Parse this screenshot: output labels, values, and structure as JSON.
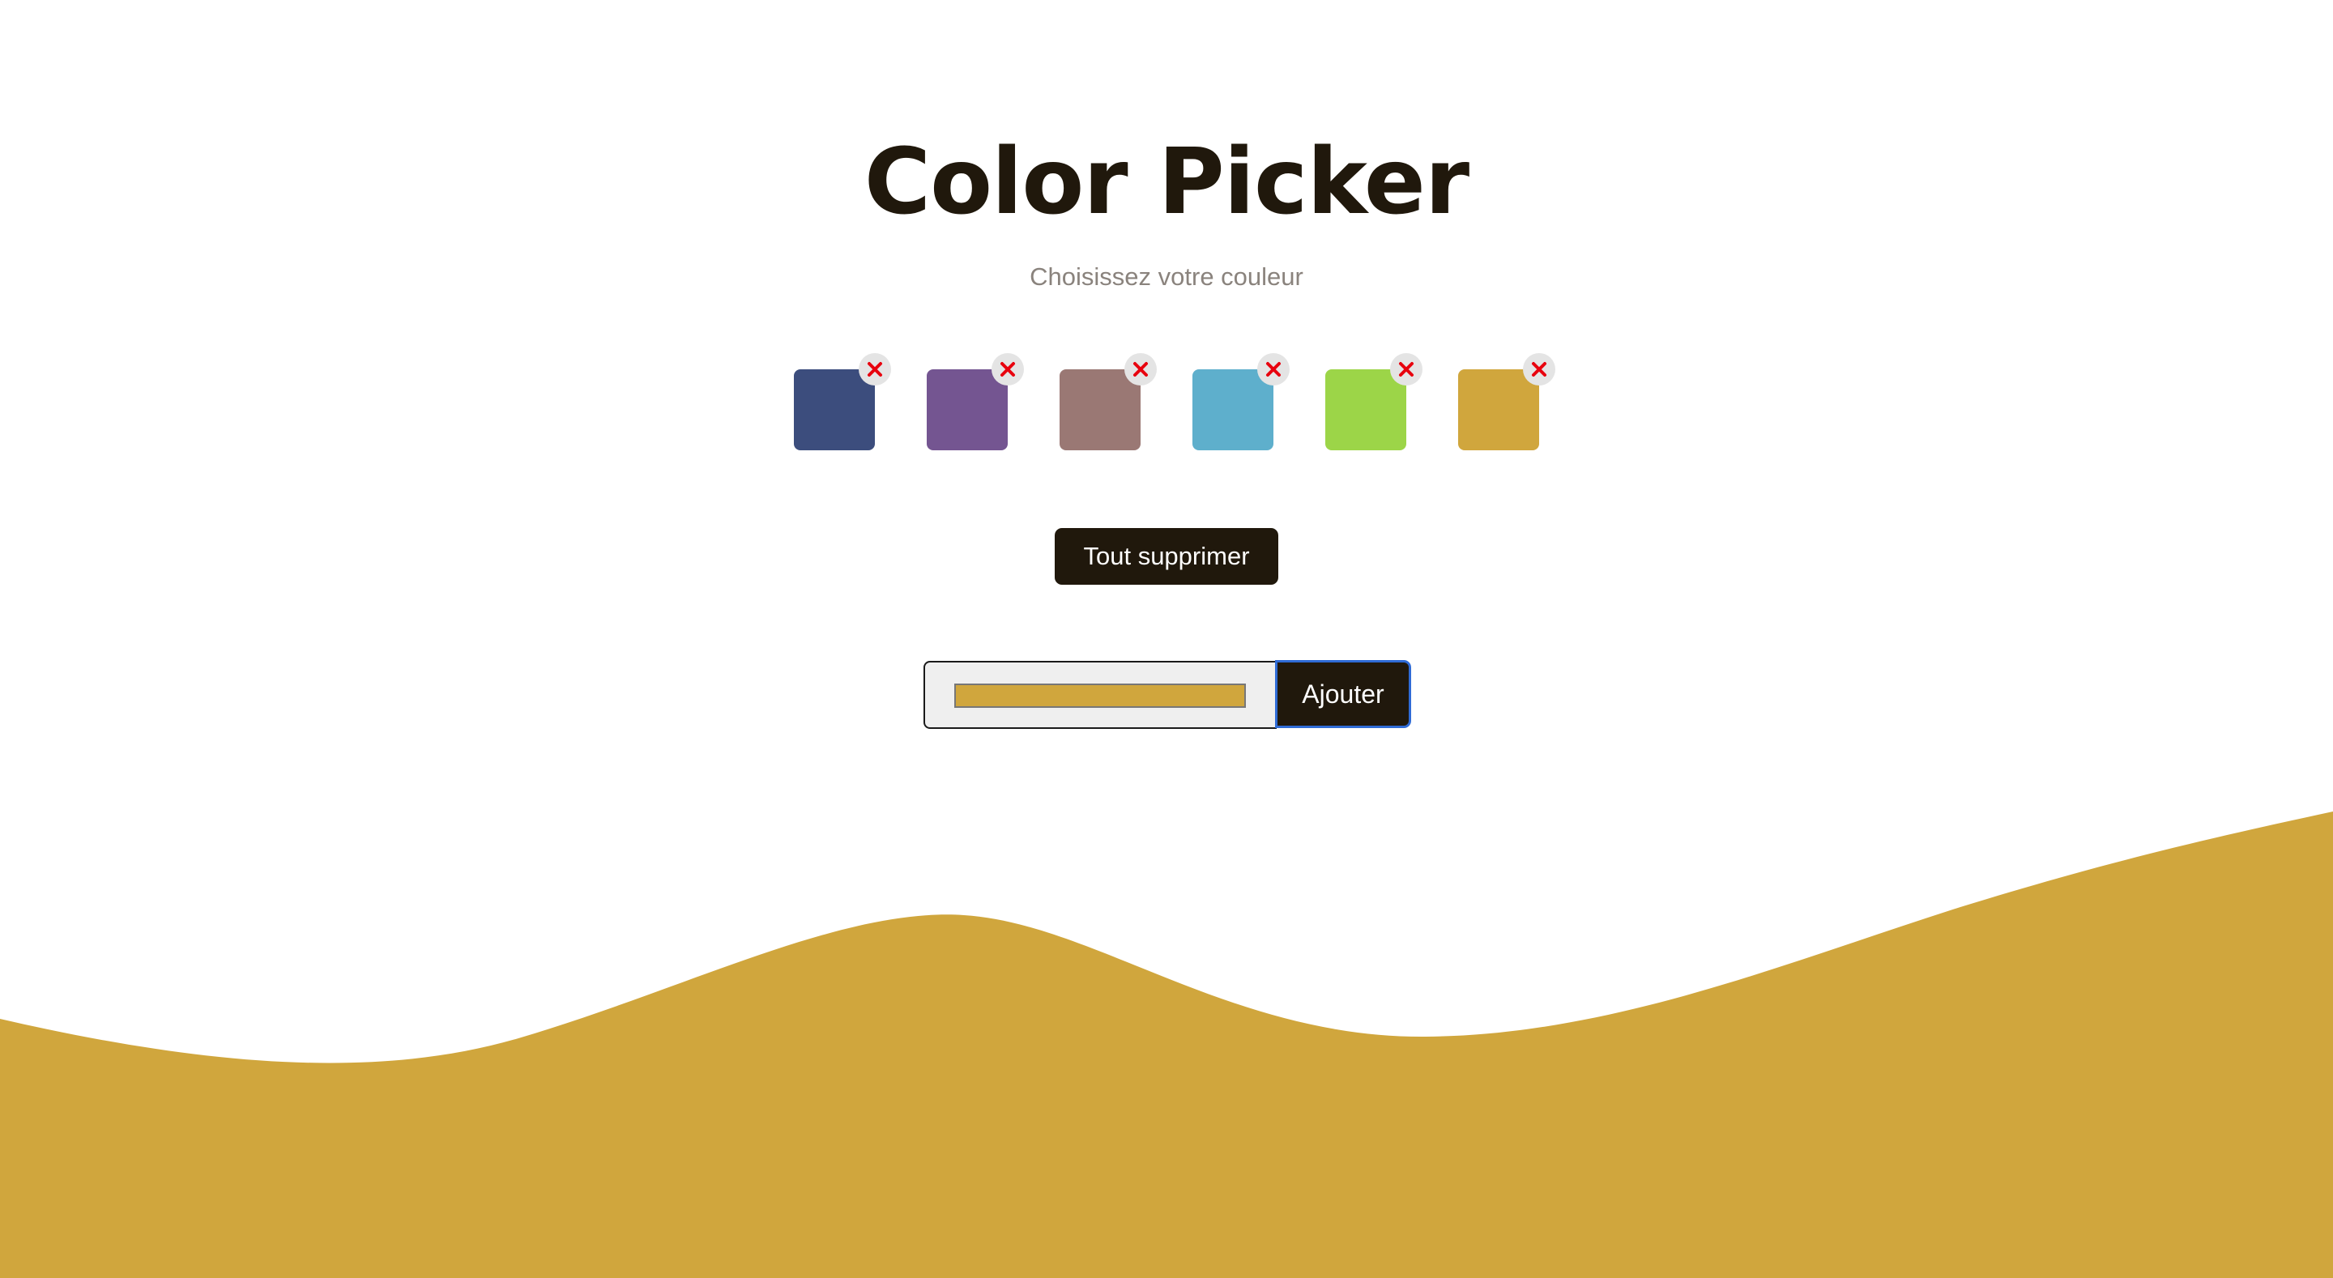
{
  "header": {
    "title": "Color Picker",
    "subtitle": "Choisissez votre couleur"
  },
  "swatches": [
    {
      "color": "#3c4d7d",
      "remove_icon": "close-icon"
    },
    {
      "color": "#745591",
      "remove_icon": "close-icon"
    },
    {
      "color": "#9a7874",
      "remove_icon": "close-icon"
    },
    {
      "color": "#5eafcc",
      "remove_icon": "close-icon"
    },
    {
      "color": "#9cd548",
      "remove_icon": "close-icon"
    },
    {
      "color": "#d0a63d",
      "remove_icon": "close-icon"
    }
  ],
  "clear_button": {
    "label": "Tout supprimer"
  },
  "add_form": {
    "color_value": "#d0a63d",
    "add_label": "Ajouter"
  },
  "theme": {
    "accent": "#d0a63d",
    "dark": "#20180c",
    "remove_icon_color": "#e8000e"
  }
}
